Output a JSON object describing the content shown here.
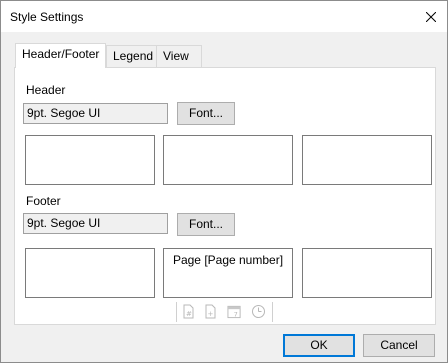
{
  "window": {
    "title": "Style Settings"
  },
  "tabs": [
    {
      "label": "Header/Footer"
    },
    {
      "label": "Legend"
    },
    {
      "label": "View"
    }
  ],
  "header": {
    "section_label": "Header",
    "font_value": "9pt. Segoe UI",
    "font_button": "Font...",
    "boxes": [
      "",
      "",
      ""
    ]
  },
  "footer": {
    "section_label": "Footer",
    "font_value": "9pt. Segoe UI",
    "font_button": "Font...",
    "boxes": [
      "",
      "Page [Page number]",
      ""
    ]
  },
  "toolbar_icons": [
    "page-number-icon",
    "page-count-icon",
    "date-icon",
    "time-icon"
  ],
  "buttons": {
    "ok": "OK",
    "cancel": "Cancel"
  },
  "colors": {
    "focus_border": "#0078d7",
    "panel_bg": "#ffffff",
    "dialog_bg": "#f0f0f0"
  }
}
